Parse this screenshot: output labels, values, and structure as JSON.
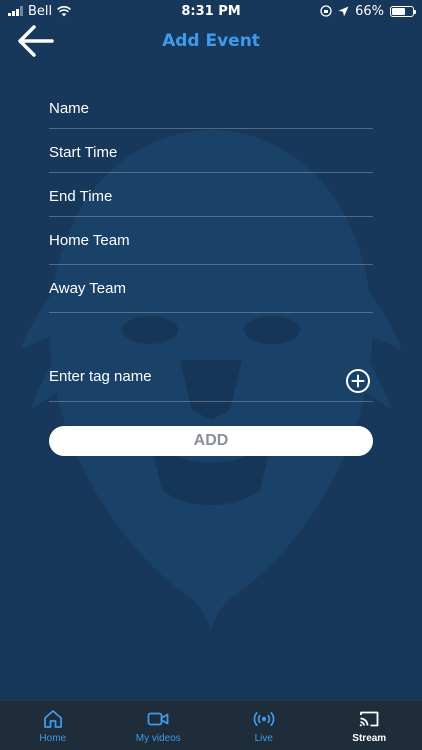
{
  "status_bar": {
    "carrier": "Bell",
    "time": "8:31 PM",
    "battery_percent": "66%",
    "battery_level": 0.66,
    "icons": [
      "signal-icon",
      "wifi-icon",
      "screen-lock-icon",
      "location-icon",
      "battery-icon"
    ]
  },
  "header": {
    "title": "Add Event",
    "back_icon": "arrow-left-icon"
  },
  "form": {
    "name_placeholder": "Name",
    "start_time_placeholder": "Start Time",
    "end_time_placeholder": "End Time",
    "home_team_placeholder": "Home Team",
    "away_team_placeholder": "Away Team",
    "tag_placeholder": "Enter tag name",
    "add_tag_icon": "plus-circle-icon",
    "add_label": "ADD"
  },
  "tab_bar": {
    "items": [
      {
        "label": "Home",
        "icon": "home-icon",
        "active": false
      },
      {
        "label": "My videos",
        "icon": "video-camera-icon",
        "active": false
      },
      {
        "label": "Live",
        "icon": "broadcast-icon",
        "active": false
      },
      {
        "label": "Stream",
        "icon": "cast-icon",
        "active": true
      }
    ]
  },
  "colors": {
    "background": "#17385a",
    "accent": "#3e9bea",
    "tab_bar": "#1f2c3a",
    "button_text": "#8a8f96"
  }
}
